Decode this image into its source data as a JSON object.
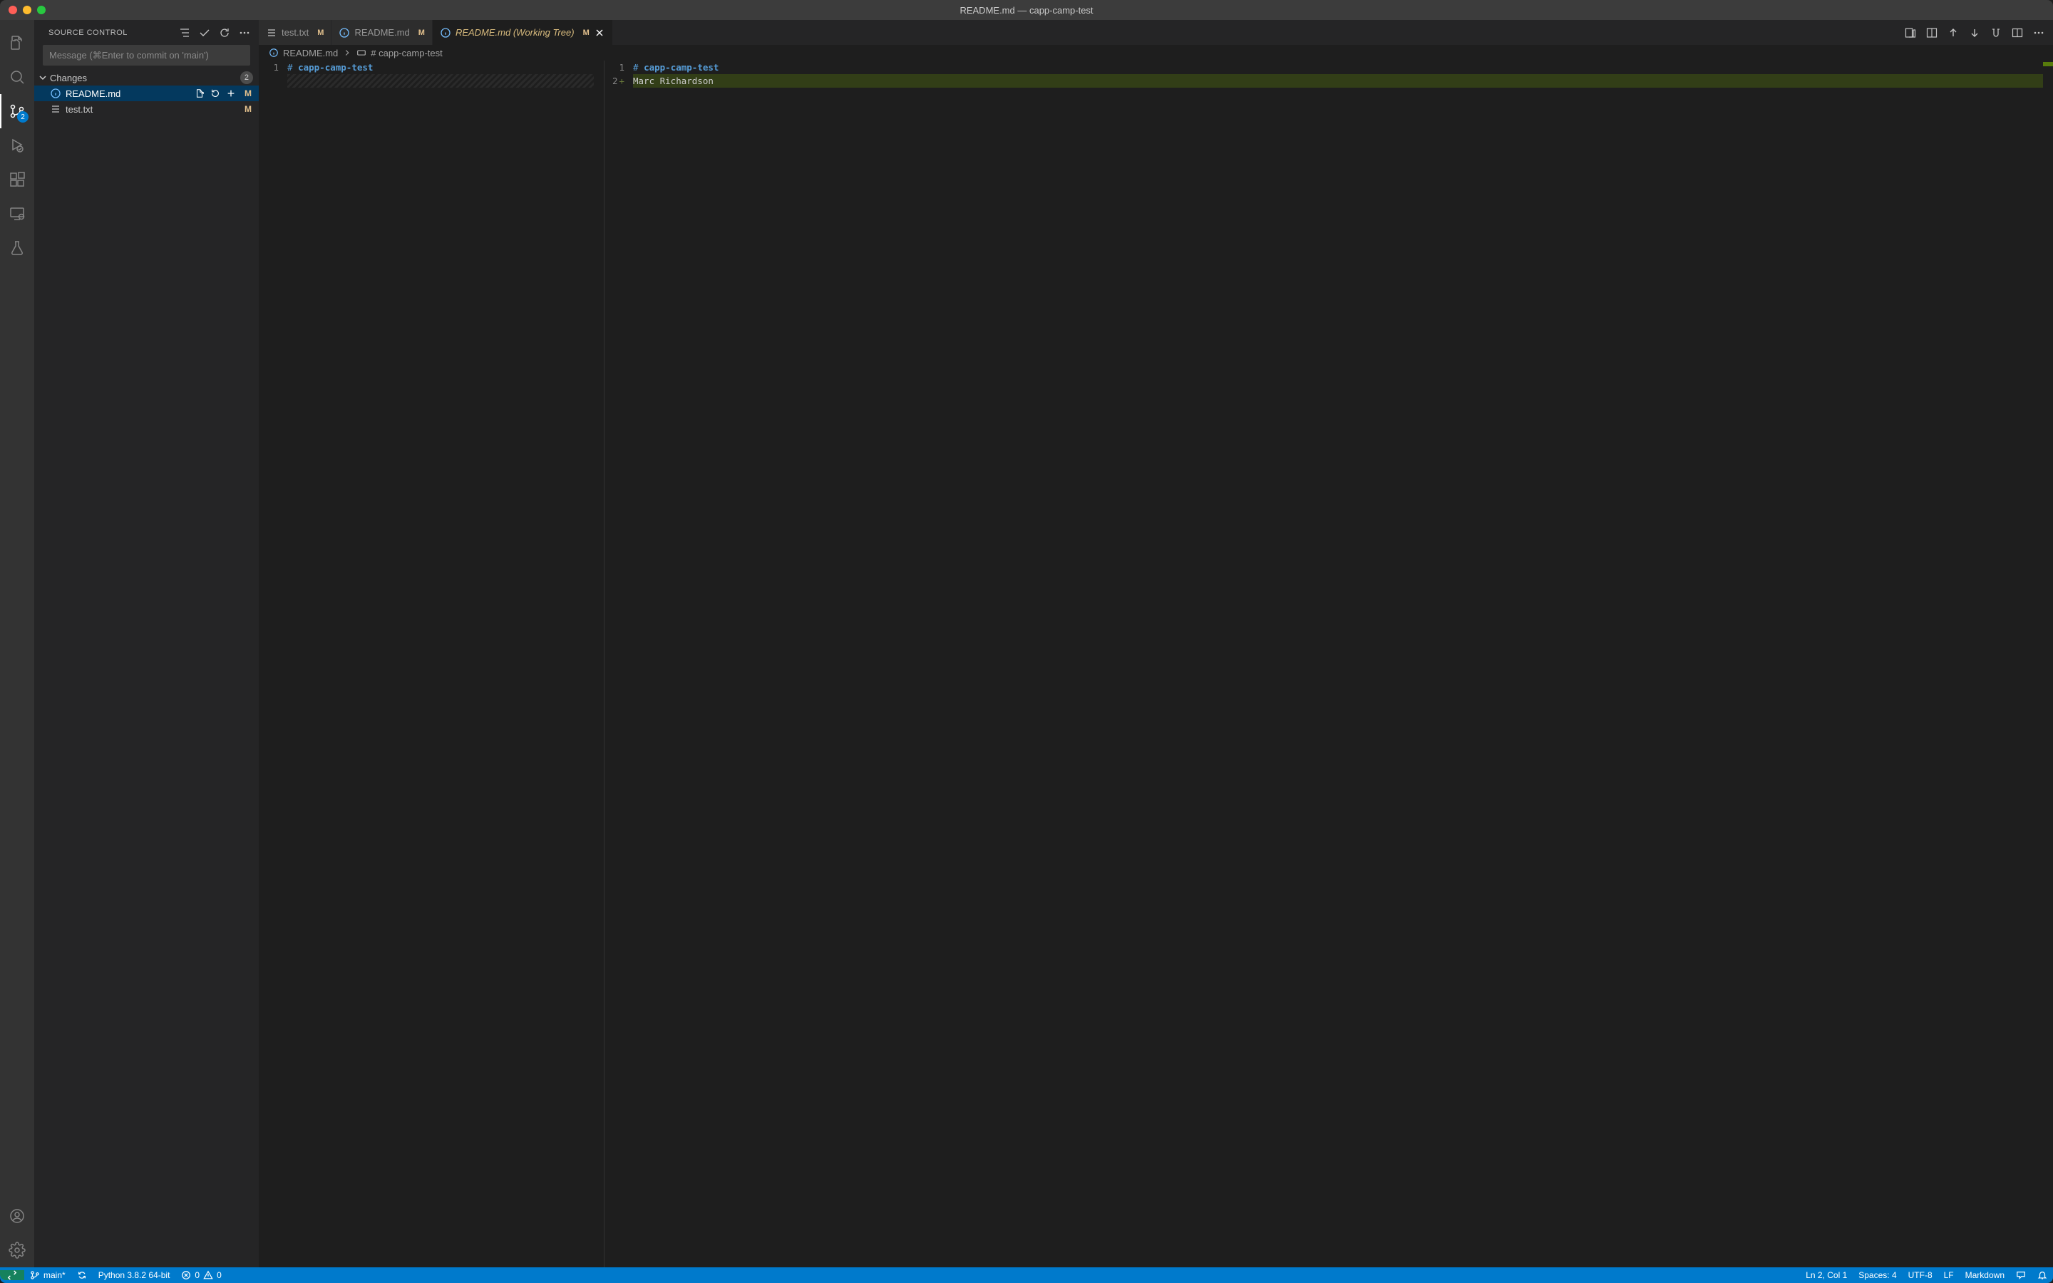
{
  "window": {
    "title": "README.md — capp-camp-test"
  },
  "activitybar": {
    "scm_badge": "2"
  },
  "sidebar": {
    "title": "SOURCE CONTROL",
    "commit_placeholder": "Message (⌘Enter to commit on 'main')",
    "changes_label": "Changes",
    "changes_count": "2",
    "files": [
      {
        "name": "README.md",
        "status": "M",
        "selected": true,
        "show_actions": true
      },
      {
        "name": "test.txt",
        "status": "M",
        "selected": false,
        "show_actions": false
      }
    ]
  },
  "tabs": [
    {
      "label": "test.txt",
      "status": "M",
      "active": false,
      "italic": false,
      "icon": "lines"
    },
    {
      "label": "README.md",
      "status": "M",
      "active": false,
      "italic": false,
      "icon": "info"
    },
    {
      "label": "README.md (Working Tree)",
      "status": "M",
      "active": true,
      "italic": true,
      "icon": "info"
    }
  ],
  "breadcrumbs": {
    "file": "README.md",
    "heading": "# capp-camp-test"
  },
  "diff": {
    "left": {
      "lines": [
        {
          "num": "1",
          "tokens": [
            {
              "t": "# ",
              "c": "tok-head-hash"
            },
            {
              "t": "capp-camp-test",
              "c": "tok-head-text"
            }
          ]
        }
      ],
      "hatched_after": true
    },
    "right": {
      "lines": [
        {
          "num": "1",
          "insert": false,
          "plus": false,
          "tokens": [
            {
              "t": "# ",
              "c": "tok-head-hash"
            },
            {
              "t": "capp-camp-test",
              "c": "tok-head-text"
            }
          ]
        },
        {
          "num": "2",
          "insert": true,
          "plus": true,
          "tokens": [
            {
              "t": "Marc Richardson",
              "c": ""
            }
          ]
        }
      ]
    }
  },
  "statusbar": {
    "branch": "main*",
    "python": "Python 3.8.2 64-bit",
    "errors": "0",
    "warnings": "0",
    "position": "Ln 2, Col 1",
    "spaces": "Spaces: 4",
    "encoding": "UTF-8",
    "eol": "LF",
    "language": "Markdown"
  }
}
